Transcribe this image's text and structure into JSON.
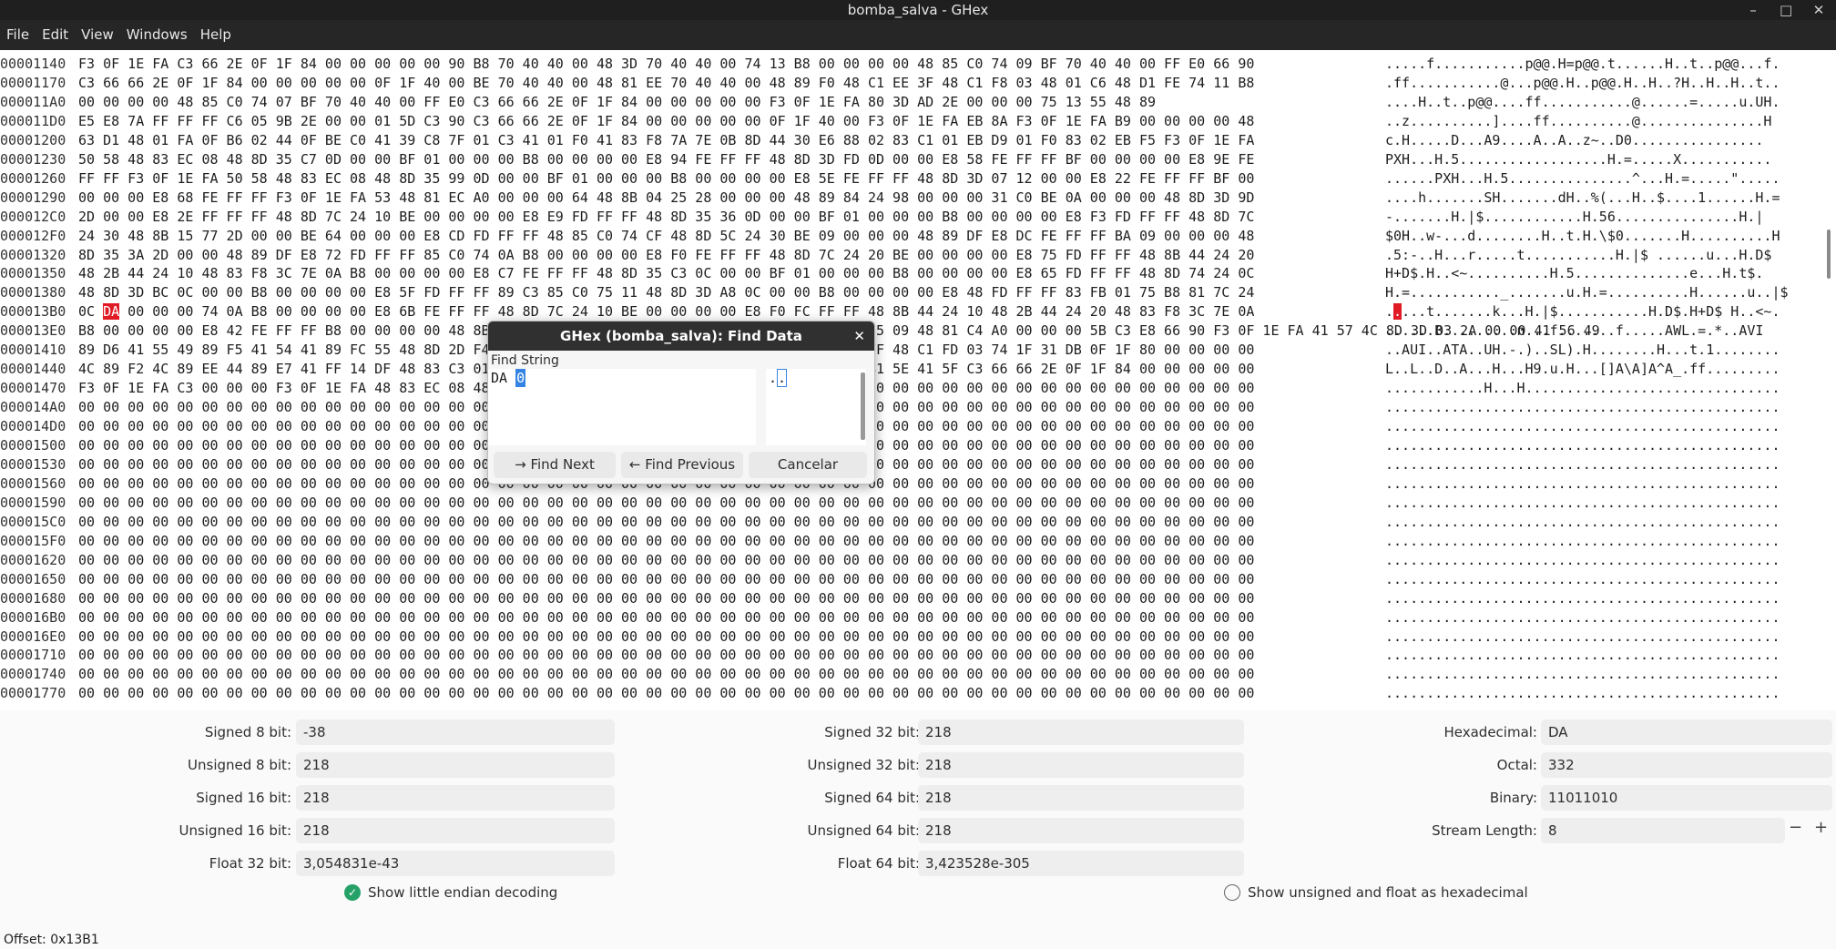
{
  "window": {
    "title": "bomba_salva - GHex"
  },
  "menu": [
    "File",
    "Edit",
    "View",
    "Windows",
    "Help"
  ],
  "hex_rows": [
    {
      "offset": "00001140",
      "hex": "F3 0F 1E FA C3 66 2E 0F 1F 84 00 00 00 00 00 90 B8 70 40 40 00 48 3D 70 40 40 00 74 13 B8 00 00 00 00 48 85 C0 74 09 BF 70 40 40 00 FF E0 66 90",
      "ascii": ".....f...........p@@.H=p@@.t......H..t..p@@...f."
    },
    {
      "offset": "00001170",
      "hex": "C3 66 66 2E 0F 1F 84 00 00 00 00 00 0F 1F 40 00 BE 70 40 40 00 48 81 EE 70 40 40 00 48 89 F0 48 C1 EE 3F 48 C1 F8 03 48 01 C6 48 D1 FE 74 11 B8",
      "ascii": ".ff...........@...p@@.H..p@@.H..H..?H..H..H..t.."
    },
    {
      "offset": "000011A0",
      "hex": "00 00 00 00 48 85 C0 74 07 BF 70 40 40 00 FF E0 C3 66 66 2E 0F 1F 84 00 00 00 00 00 F3 0F 1E FA 80 3D AD 2E 00 00 00 75 13 55 48 89",
      "ascii": "....H..t..p@@....ff...........@......=.....u.UH."
    },
    {
      "offset": "000011D0",
      "hex": "E5 E8 7A FF FF FF C6 05 9B 2E 00 00 01 5D C3 90 C3 66 66 2E 0F 1F 84 00 00 00 00 00 0F 1F 40 00 F3 0F 1E FA EB 8A F3 0F 1E FA B9 00 00 00 00 48",
      "ascii": "..z..........]....ff..........@...............H"
    },
    {
      "offset": "00001200",
      "hex": "63 D1 48 01 FA 0F B6 02 44 0F BE C0 41 39 C8 7F 01 C3 41 01 F0 41 83 F8 7A 7E 0B 8D 44 30 E6 88 02 83 C1 01 EB D9 01 F0 83 02 EB F5 F3 0F 1E FA",
      "ascii": "c.H.....D...A9....A..A..z~..D0................"
    },
    {
      "offset": "00001230",
      "hex": "50 58 48 83 EC 08 48 8D 35 C7 0D 00 00 BF 01 00 00 00 B8 00 00 00 00 E8 94 FE FF FF 48 8D 3D FD 0D 00 00 E8 58 FE FF FF BF 00 00 00 00 E8 9E FE",
      "ascii": "PXH...H.5..................H.=.....X..........."
    },
    {
      "offset": "00001260",
      "hex": "FF FF F3 0F 1E FA 50 58 48 83 EC 08 48 8D 35 99 0D 00 00 BF 01 00 00 00 B8 00 00 00 00 E8 5E FE FF FF 48 8D 3D 07 12 00 00 E8 22 FE FF FF BF 00",
      "ascii": "......PXH...H.5...............^...H.=.....\"....."
    },
    {
      "offset": "00001290",
      "hex": "00 00 00 E8 68 FE FF FF F3 0F 1E FA 53 48 81 EC A0 00 00 00 64 48 8B 04 25 28 00 00 00 48 89 84 24 98 00 00 00 31 C0 BE 0A 00 00 00 48 8D 3D 9D",
      "ascii": "....h.......SH.......dH..%(...H..$....1......H.="
    },
    {
      "offset": "000012C0",
      "hex": "2D 00 00 E8 2E FF FF FF 48 8D 7C 24 10 BE 00 00 00 00 E8 E9 FD FF FF 48 8D 35 36 0D 00 00 BF 01 00 00 00 B8 00 00 00 00 E8 F3 FD FF FF 48 8D 7C",
      "ascii": "-.......H.|$............H.56...............H.|"
    },
    {
      "offset": "000012F0",
      "hex": "24 30 48 8B 15 77 2D 00 00 BE 64 00 00 00 E8 CD FD FF FF 48 85 C0 74 CF 48 8D 5C 24 30 BE 09 00 00 00 48 89 DF E8 DC FE FF FF BA 09 00 00 00 48",
      "ascii": "$0H..w-...d........H..t.H.\\$0.......H..........H"
    },
    {
      "offset": "00001320",
      "hex": "8D 35 3A 2D 00 00 48 89 DF E8 72 FD FF FF 85 C0 74 0A B8 00 00 00 00 E8 F0 FE FF FF 48 8D 7C 24 20 BE 00 00 00 00 E8 75 FD FF FF 48 8B 44 24 20",
      "ascii": ".5:-..H...r.....t...........H.|$ ......u...H.D$ "
    },
    {
      "offset": "00001350",
      "hex": "48 2B 44 24 10 48 83 F8 3C 7E 0A B8 00 00 00 00 E8 C7 FE FF FF 48 8D 35 C3 0C 00 00 BF 01 00 00 00 B8 00 00 00 00 E8 65 FD FF FF 48 8D 74 24 0C",
      "ascii": "H+D$.H..<~..........H.5..............e...H.t$."
    },
    {
      "offset": "00001380",
      "hex": "48 8D 3D BC 0C 00 00 B8 00 00 00 00 E8 5F FD FF FF 89 C3 85 C0 75 11 48 8D 3D A8 0C 00 00 B8 00 00 00 00 E8 48 FD FF FF 83 FB 01 75 B8 81 7C 24",
      "ascii": "H.=..........._.......u.H.=..........H......u..|$"
    },
    {
      "offset": "000013B0",
      "hex_pre": "0C ",
      "hex_hl": "DA",
      "hex_post": " 00 00 00 74 0A B8 00 00 00 00 E8 6B FE FF FF 48 8D 7C 24 10 BE 00 00 00 00 E8 F0 FC FF FF 48 8B 44 24 10 48 2B 44 24 20 48 83 F8 3C 7E 0A",
      "ascii_pre": ".",
      "ascii_hl": ".",
      "ascii_post": "...t.......k...H.|$...........H.D$.H+D$ H..<~."
    },
    {
      "offset": "000013E0",
      "hex": "B8 00 00 00 00 E8 42 FE FF FF B8 00 00 00 00 48 8B 94 24 98 00 00 00 64 48 2B 14 25 28 00 00 00 75 09 48 81 C4 A0 00 00 00 5B C3 E8 66 90 F3 0F 1E FA 41 57 4C 8D 3D 03 2A 00 00 41 56 49",
      "ascii": "......B.........n...f.......f.....AWL.=.*..AVI"
    },
    {
      "offset": "00001410",
      "hex": "89 D6 41 55 49 89 F5 41 54 41 89 FC 55 48 8D 2D F4 29 00 00 53 4C 29 FD 48 83 EC 08 E8 88 FB FF FF 48 C1 FD 03 74 1F 31 DB 0F 1F 80 00 00 00 00",
      "ascii": "..AUI..ATA..UH.-.)..SL).H........H...t.1........"
    },
    {
      "offset": "00001440",
      "hex": "4C 89 F2 4C 89 EE 44 89 E7 41 FF 14 DF 48 83 C3 01 48 39 DD 75 EA 48 83 C4 08 5B 5D 41 5C 41 5D 41 5E 41 5F C3 66 66 2E 0F 1F 84 00 00 00 00 00",
      "ascii": "L..L..D..A...H...H9.u.H...[]A\\A]A^A_.ff........."
    },
    {
      "offset": "00001470",
      "hex": "F3 0F 1E FA C3 00 00 00 F3 0F 1E FA 48 83 EC 08 48 83 C4 08 C3 00 00 00 00 00 00 00 00 00 00 00 00 00 00 00 00 00 00 00 00 00 00 00 00 00 00 00",
      "ascii": "............H...H..............................."
    },
    {
      "offset": "000014A0",
      "hex": "00 00 00 00 00 00 00 00 00 00 00 00 00 00 00 00 00 00 00 00 00 00 00 00 00 00 00 00 00 00 00 00 00 00 00 00 00 00 00 00 00 00 00 00 00 00 00 00",
      "ascii": "................................................"
    },
    {
      "offset": "000014D0",
      "hex": "00 00 00 00 00 00 00 00 00 00 00 00 00 00 00 00 00 00 00 00 00 00 00 00 00 00 00 00 00 00 00 00 00 00 00 00 00 00 00 00 00 00 00 00 00 00 00 00",
      "ascii": "................................................"
    },
    {
      "offset": "00001500",
      "hex": "00 00 00 00 00 00 00 00 00 00 00 00 00 00 00 00 00 00 00 00 00 00 00 00 00 00 00 00 00 00 00 00 00 00 00 00 00 00 00 00 00 00 00 00 00 00 00 00",
      "ascii": "................................................"
    },
    {
      "offset": "00001530",
      "hex": "00 00 00 00 00 00 00 00 00 00 00 00 00 00 00 00 00 00 00 00 00 00 00 00 00 00 00 00 00 00 00 00 00 00 00 00 00 00 00 00 00 00 00 00 00 00 00 00",
      "ascii": "................................................"
    },
    {
      "offset": "00001560",
      "hex": "00 00 00 00 00 00 00 00 00 00 00 00 00 00 00 00 00 00 00 00 00 00 00 00 00 00 00 00 00 00 00 00 00 00 00 00 00 00 00 00 00 00 00 00 00 00 00 00",
      "ascii": "................................................"
    },
    {
      "offset": "00001590",
      "hex": "00 00 00 00 00 00 00 00 00 00 00 00 00 00 00 00 00 00 00 00 00 00 00 00 00 00 00 00 00 00 00 00 00 00 00 00 00 00 00 00 00 00 00 00 00 00 00 00",
      "ascii": "................................................"
    },
    {
      "offset": "000015C0",
      "hex": "00 00 00 00 00 00 00 00 00 00 00 00 00 00 00 00 00 00 00 00 00 00 00 00 00 00 00 00 00 00 00 00 00 00 00 00 00 00 00 00 00 00 00 00 00 00 00 00",
      "ascii": "................................................"
    },
    {
      "offset": "000015F0",
      "hex": "00 00 00 00 00 00 00 00 00 00 00 00 00 00 00 00 00 00 00 00 00 00 00 00 00 00 00 00 00 00 00 00 00 00 00 00 00 00 00 00 00 00 00 00 00 00 00 00",
      "ascii": "................................................"
    },
    {
      "offset": "00001620",
      "hex": "00 00 00 00 00 00 00 00 00 00 00 00 00 00 00 00 00 00 00 00 00 00 00 00 00 00 00 00 00 00 00 00 00 00 00 00 00 00 00 00 00 00 00 00 00 00 00 00",
      "ascii": "................................................"
    },
    {
      "offset": "00001650",
      "hex": "00 00 00 00 00 00 00 00 00 00 00 00 00 00 00 00 00 00 00 00 00 00 00 00 00 00 00 00 00 00 00 00 00 00 00 00 00 00 00 00 00 00 00 00 00 00 00 00",
      "ascii": "................................................"
    },
    {
      "offset": "00001680",
      "hex": "00 00 00 00 00 00 00 00 00 00 00 00 00 00 00 00 00 00 00 00 00 00 00 00 00 00 00 00 00 00 00 00 00 00 00 00 00 00 00 00 00 00 00 00 00 00 00 00",
      "ascii": "................................................"
    },
    {
      "offset": "000016B0",
      "hex": "00 00 00 00 00 00 00 00 00 00 00 00 00 00 00 00 00 00 00 00 00 00 00 00 00 00 00 00 00 00 00 00 00 00 00 00 00 00 00 00 00 00 00 00 00 00 00 00",
      "ascii": "................................................"
    },
    {
      "offset": "000016E0",
      "hex": "00 00 00 00 00 00 00 00 00 00 00 00 00 00 00 00 00 00 00 00 00 00 00 00 00 00 00 00 00 00 00 00 00 00 00 00 00 00 00 00 00 00 00 00 00 00 00 00",
      "ascii": "................................................"
    },
    {
      "offset": "00001710",
      "hex": "00 00 00 00 00 00 00 00 00 00 00 00 00 00 00 00 00 00 00 00 00 00 00 00 00 00 00 00 00 00 00 00 00 00 00 00 00 00 00 00 00 00 00 00 00 00 00 00",
      "ascii": "................................................"
    },
    {
      "offset": "00001740",
      "hex": "00 00 00 00 00 00 00 00 00 00 00 00 00 00 00 00 00 00 00 00 00 00 00 00 00 00 00 00 00 00 00 00 00 00 00 00 00 00 00 00 00 00 00 00 00 00 00 00",
      "ascii": "................................................"
    },
    {
      "offset": "00001770",
      "hex": "00 00 00 00 00 00 00 00 00 00 00 00 00 00 00 00 00 00 00 00 00 00 00 00 00 00 00 00 00 00 00 00 00 00 00 00 00 00 00 00 00 00 00 00 00 00 00 00",
      "ascii": "................................................"
    }
  ],
  "panel": {
    "col1": [
      {
        "label": "Signed 8 bit:",
        "value": "-38"
      },
      {
        "label": "Unsigned 8 bit:",
        "value": "218"
      },
      {
        "label": "Signed 16 bit:",
        "value": "218"
      },
      {
        "label": "Unsigned 16 bit:",
        "value": "218"
      },
      {
        "label": "Float 32 bit:",
        "value": "3,054831e-43"
      }
    ],
    "col2": [
      {
        "label": "Signed 32 bit:",
        "value": "218"
      },
      {
        "label": "Unsigned 32 bit:",
        "value": "218"
      },
      {
        "label": "Signed 64 bit:",
        "value": "218"
      },
      {
        "label": "Unsigned 64 bit:",
        "value": "218"
      },
      {
        "label": "Float 64 bit:",
        "value": "3,423528e-305"
      }
    ],
    "col3": [
      {
        "label": "Hexadecimal:",
        "value": "DA"
      },
      {
        "label": "Octal:",
        "value": "332"
      },
      {
        "label": "Binary:",
        "value": "11011010"
      },
      {
        "label": "Stream Length:",
        "value": "8"
      }
    ],
    "stepper_minus": "−",
    "stepper_plus": "+",
    "check_little_endian": "Show little endian decoding",
    "check_hex": "Show unsigned and float as hexadecimal"
  },
  "status": {
    "offset": "Offset: 0x13B1"
  },
  "dialog": {
    "title": "GHex (bomba_salva): Find Data",
    "label": "Find String",
    "hex_value": "DA",
    "hex_cursor": "0",
    "ascii_value": ".",
    "ascii_cursor": ".",
    "find_next": "Find Next",
    "find_prev": "Find Previous",
    "cancel": "Cancelar"
  },
  "colors": {
    "highlight": "#e01b24",
    "check_accent": "#26a269",
    "cursor": "#3584e4"
  }
}
